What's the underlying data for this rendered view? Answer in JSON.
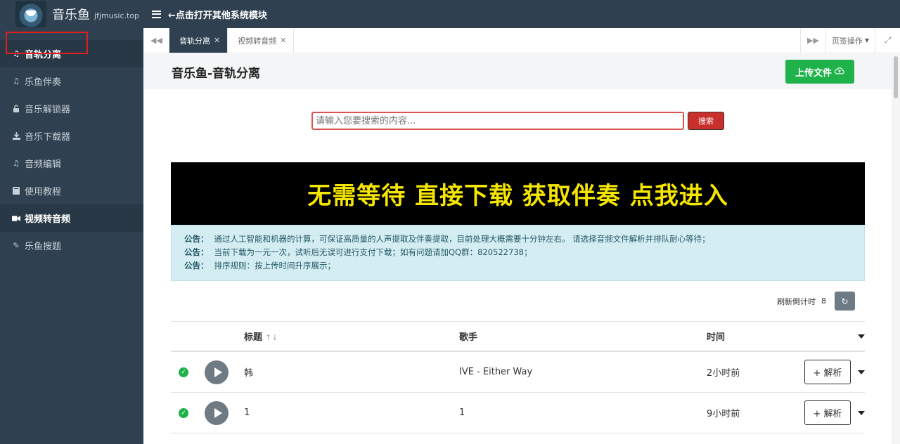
{
  "header": {
    "app_name": "音乐鱼",
    "domain": "jfjmusic.top",
    "menu_toggle_text": "←点击打开其他系统模块"
  },
  "sidebar": {
    "items": [
      {
        "label": "音轨分离",
        "icon": "music-note-icon"
      },
      {
        "label": "乐鱼伴奏",
        "icon": "music-note-icon"
      },
      {
        "label": "音乐解锁器",
        "icon": "unlock-icon"
      },
      {
        "label": "音乐下载器",
        "icon": "download-icon"
      },
      {
        "label": "音频编辑",
        "icon": "music-note-icon"
      },
      {
        "label": "使用教程",
        "icon": "book-icon"
      },
      {
        "label": "视频转音频",
        "icon": "video-camera-icon"
      },
      {
        "label": "乐鱼搜题",
        "icon": "pencil-icon"
      }
    ],
    "active_index": 0,
    "highlight_color": "#e02020"
  },
  "tabs": {
    "items": [
      {
        "label": "音轨分离",
        "active": true
      },
      {
        "label": "视频转音频",
        "active": false
      }
    ],
    "ops_label": "页签操作"
  },
  "page": {
    "title": "音乐鱼-音轨分离",
    "upload_label": "上传文件"
  },
  "search": {
    "placeholder": "请输入您要搜索的内容...",
    "button_label": "搜索"
  },
  "banner": {
    "text": "无需等待 直接下载 获取伴奏 点我进入",
    "text_color": "#f5e600"
  },
  "notices": [
    {
      "label": "公告：",
      "text": "通过人工智能和机器的计算，可保证高质量的人声提取及伴奏提取，目前处理大概需要十分钟左右。 请选择音频文件解析并排队耐心等待；"
    },
    {
      "label": "公告：",
      "text": "当前下载为一元一次，试听后无误可进行支付下载；如有问题请加QQ群：820522738；"
    },
    {
      "label": "公告：",
      "text": "排序规则：按上传时间升序展示；"
    }
  ],
  "refresh": {
    "label": "刷新倒计时",
    "count": "8"
  },
  "table": {
    "headers": {
      "title": "标题",
      "artist": "歌手",
      "time": "时间"
    },
    "rows": [
      {
        "title": "韩",
        "artist": "IVE - Either Way",
        "time": "2小时前",
        "action": "+ 解析"
      },
      {
        "title": "1",
        "artist": "1",
        "time": "9小时前",
        "action": "+ 解析"
      }
    ]
  },
  "colors": {
    "sidebar_bg": "#2f4050",
    "accent_green": "#1fb14a",
    "search_red": "#c9302c",
    "notice_bg": "#d4edf3"
  }
}
